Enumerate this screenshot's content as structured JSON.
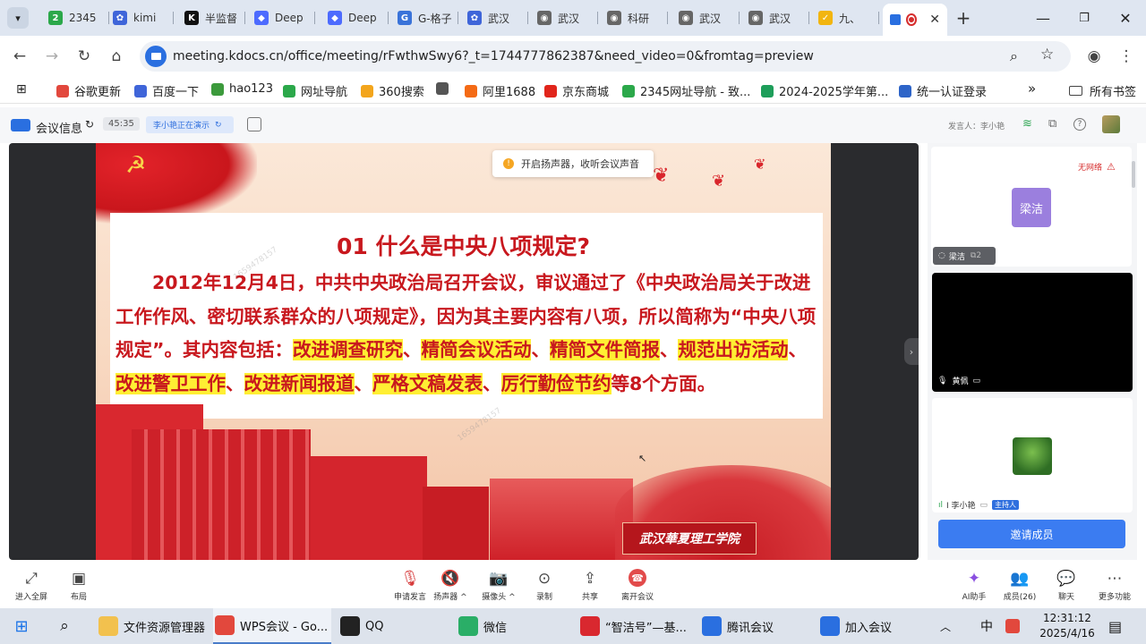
{
  "browser": {
    "tabs": [
      {
        "label": "2345",
        "color": "#2ba84a",
        "glyph": "2"
      },
      {
        "label": "kimi",
        "color": "#3f65d9",
        "glyph": "✿"
      },
      {
        "label": "半监督",
        "color": "#111111",
        "glyph": "K"
      },
      {
        "label": "Deep",
        "color": "#4d6bfe",
        "glyph": "◆"
      },
      {
        "label": "Deep",
        "color": "#4d6bfe",
        "glyph": "◆"
      },
      {
        "label": "G-格子",
        "color": "#3a73d9",
        "glyph": "G"
      },
      {
        "label": "武汉",
        "color": "#3f65d9",
        "glyph": "✿"
      },
      {
        "label": "武汉",
        "color": "#666666",
        "glyph": "◉"
      },
      {
        "label": "科研",
        "color": "#666666",
        "glyph": "◉"
      },
      {
        "label": "武汉",
        "color": "#666666",
        "glyph": "◉"
      },
      {
        "label": "武汉",
        "color": "#666666",
        "glyph": "◉"
      },
      {
        "label": "九、",
        "color": "#f2b50f",
        "glyph": "✓"
      }
    ],
    "active_tab_icon": "meeting-camera-icon",
    "url": "meeting.kdocs.cn/office/meeting/rFwthwSwy6?_t=1744777862387&need_video=0&fromtag=preview",
    "bookmarks": [
      {
        "label": "谷歌更新",
        "color": "#e2483d"
      },
      {
        "label": "百度一下",
        "color": "#3f65d9"
      },
      {
        "label": "hao123",
        "color": "#3c9a3c"
      },
      {
        "label": "网址导航",
        "color": "#2ba84a"
      },
      {
        "label": "360搜索",
        "color": "#f3a51c"
      },
      {
        "label": "",
        "color": "#555555"
      },
      {
        "label": "阿里1688",
        "color": "#f46a15"
      },
      {
        "label": "京东商城",
        "color": "#e1251b"
      },
      {
        "label": "2345网址导航 - 致...",
        "color": "#2ba84a"
      },
      {
        "label": "2024-2025学年第...",
        "color": "#1e9e5a"
      },
      {
        "label": "统一认证登录",
        "color": "#2d64c8"
      }
    ],
    "bookmarks_more": "»",
    "all_bookmarks": "所有书签"
  },
  "meeting": {
    "info_label": "会议信息",
    "timer": "45:35",
    "presenting_badge": "李小艳正在演示",
    "presenter_label": "发言人：李小艳",
    "speaker_tip": "开启扬声器，收听会议声音",
    "network_status": "无网络",
    "participants": [
      {
        "name": "梁洁",
        "avatar_text": "梁洁",
        "count": "2"
      },
      {
        "name": "黄佩"
      },
      {
        "name": "I 李小艳",
        "role": "主持人"
      }
    ],
    "invite_button": "邀请成员"
  },
  "slide": {
    "title": "01 什么是中央八项规定?",
    "body_plain_1": "2012年12月4日，中共中央政治局召开会议，审议通过了《中央政治局关于改进工作作风、密切联系群众的八项规定》，因为其主要内容有八项，所以简称为“中央八项规定”。其内容包括：",
    "items": [
      "改进调查研究",
      "精简会议活动",
      "精简文件简报",
      "规范出访活动",
      "改进警卫工作",
      "改进新闻报道",
      "严格文稿发表",
      "厉行勤俭节约"
    ],
    "body_tail": "等8个方面。",
    "watermark": "1659478157",
    "school_name": "武汉華夏理工学院"
  },
  "toolbar": {
    "left": [
      {
        "label": "进入全屏",
        "icon": "fullscreen-icon",
        "glyph": "⤢"
      },
      {
        "label": "布局",
        "icon": "layout-icon",
        "glyph": "▣"
      }
    ],
    "center": [
      {
        "label": "申请发言",
        "icon": "mic-muted-icon",
        "glyph": "🎙"
      },
      {
        "label": "扬声器 ^",
        "icon": "speaker-muted-icon",
        "glyph": "🔇"
      },
      {
        "label": "摄像头 ^",
        "icon": "camera-off-icon",
        "glyph": "📷"
      },
      {
        "label": "录制",
        "icon": "record-icon",
        "glyph": "⊙"
      },
      {
        "label": "共享",
        "icon": "share-icon",
        "glyph": "⇪"
      },
      {
        "label": "离开会议",
        "icon": "leave-icon",
        "glyph": "☎"
      }
    ],
    "right": [
      {
        "label": "AI助手",
        "icon": "ai-assistant-icon",
        "glyph": "✦"
      },
      {
        "label": "成员(26)",
        "icon": "members-icon",
        "glyph": "👥"
      },
      {
        "label": "聊天",
        "icon": "chat-icon",
        "glyph": "💬"
      },
      {
        "label": "更多功能",
        "icon": "more-icon",
        "glyph": "⋯"
      }
    ]
  },
  "taskbar": {
    "apps": [
      {
        "label": "文件资源管理器",
        "color": "#f2c14e"
      },
      {
        "label": "WPS会议 - Go...",
        "color": "#e2483d"
      },
      {
        "label": "QQ",
        "color": "#222222"
      },
      {
        "label": "微信",
        "color": "#2aae67"
      },
      {
        "label": "“智洁号”—基...",
        "color": "#d9282f"
      },
      {
        "label": "腾讯会议",
        "color": "#2a6fe0"
      },
      {
        "label": "加入会议",
        "color": "#2a6fe0"
      }
    ],
    "ime": "中",
    "time": "12:31:12",
    "date": "2025/4/16"
  }
}
